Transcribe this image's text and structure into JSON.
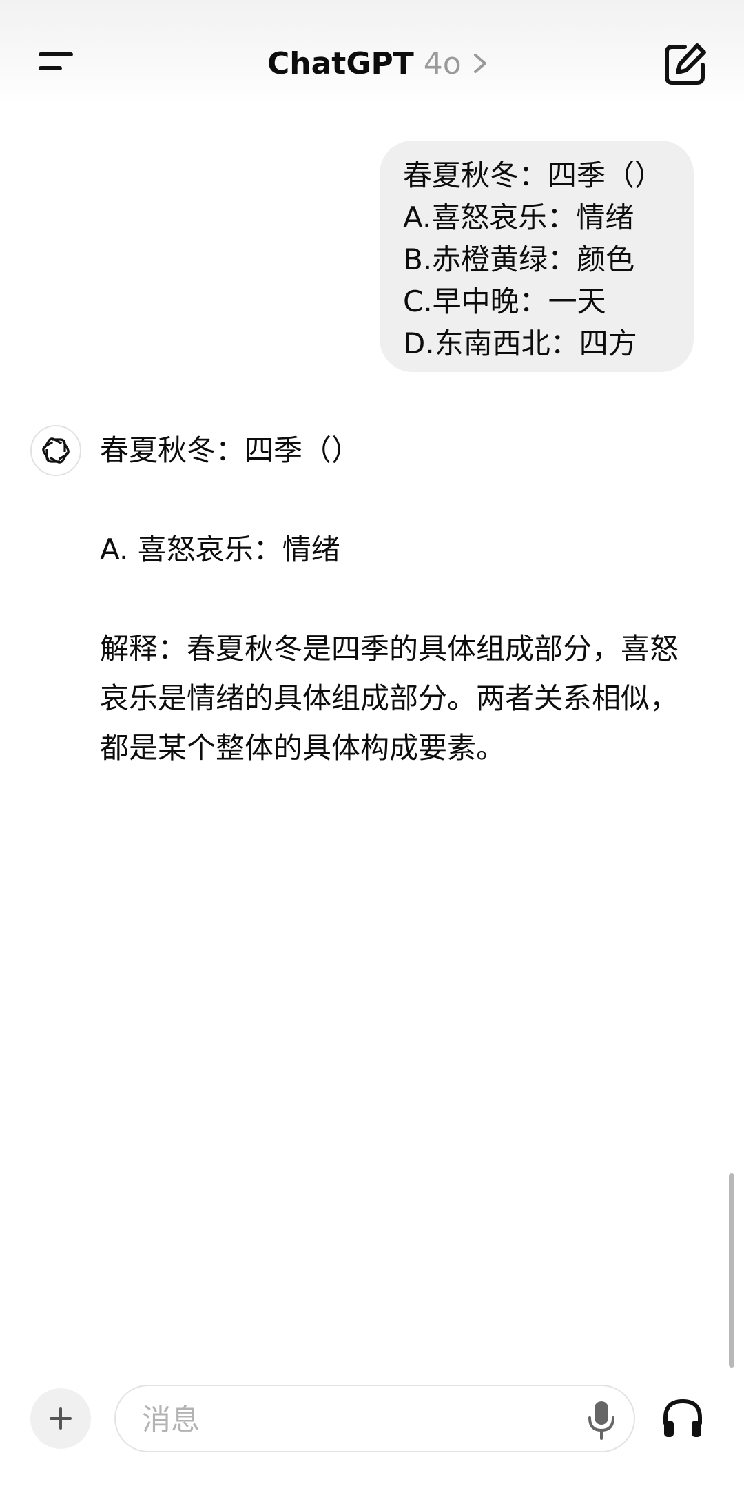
{
  "header": {
    "title": "ChatGPT",
    "model": "4o",
    "icons": {
      "menu": "menu-icon",
      "chevron": "chevron-right-icon",
      "new_chat": "edit-icon"
    }
  },
  "conversation": {
    "user_message": {
      "lines": [
        "春夏秋冬：四季（）",
        "A.喜怒哀乐：情绪",
        "B.赤橙黄绿：颜色",
        "C.早中晚：一天",
        "D.东南西北：四方"
      ]
    },
    "assistant_message": {
      "question": "春夏秋冬：四季（）",
      "answer": "A. 喜怒哀乐：情绪",
      "explanation": "解释：春夏秋冬是四季的具体组成部分，喜怒哀乐是情绪的具体组成部分。两者关系相似，都是某个整体的具体构成要素。"
    }
  },
  "composer": {
    "placeholder": "消息",
    "value": "",
    "icons": {
      "plus": "plus-icon",
      "mic": "microphone-icon",
      "voice": "headphones-icon"
    }
  },
  "colors": {
    "bubble": "#efefef",
    "placeholder": "#b3b3b3",
    "model_label": "#9a9a9a"
  }
}
